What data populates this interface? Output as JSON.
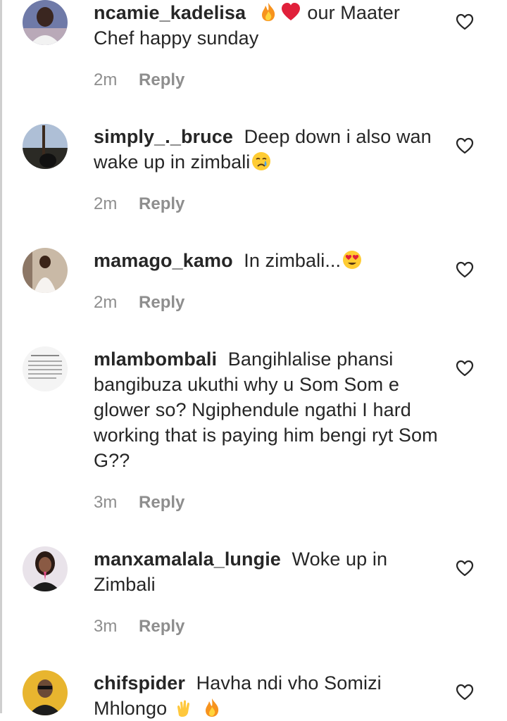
{
  "comments": [
    {
      "username": "ncamie_kadelisa",
      "text_after_emoji": "our Maater Chef happy sunday",
      "emojis": [
        "fire-emoji",
        "red-heart-emoji"
      ],
      "time": "2m",
      "reply_label": "Reply"
    },
    {
      "username": "simply_._bruce",
      "text": "Deep down i also wan wake up in zimbali",
      "emojis": [
        "crying-face-emoji"
      ],
      "time": "2m",
      "reply_label": "Reply"
    },
    {
      "username": "mamago_kamo",
      "text": "In zimbali...",
      "emojis": [
        "heart-eyes-emoji"
      ],
      "time": "2m",
      "reply_label": "Reply"
    },
    {
      "username": "mlambombali",
      "text": "Bangihlalise phansi bangibuza ukuthi why u Som Som e glower so? Ngiphendule ngathi I hard working that is paying him bengi ryt Som G??",
      "time": "3m",
      "reply_label": "Reply"
    },
    {
      "username": "manxamalala_lungie",
      "text": "Woke up in Zimbali",
      "time": "3m",
      "reply_label": "Reply"
    },
    {
      "username": "chifspider",
      "text": "Havha ndi vho Somizi Mhlongo",
      "emojis": [
        "clapping-hands-emoji",
        "fire-emoji"
      ]
    }
  ],
  "colors": {
    "text": "#262626",
    "meta": "#8e8e8e",
    "heart_outline": "#262626",
    "fire": "#f7931e",
    "heart_red": "#e0203a"
  }
}
